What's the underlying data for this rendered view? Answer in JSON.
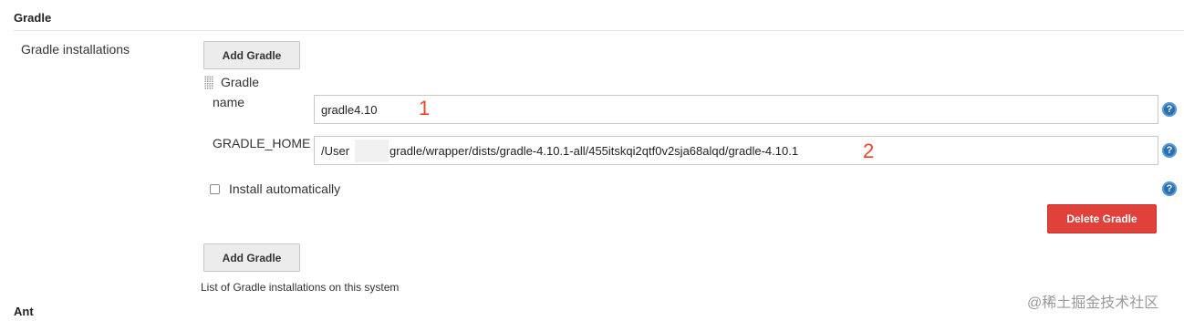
{
  "section_gradle": {
    "title": "Gradle"
  },
  "installations": {
    "label": "Gradle installations",
    "add_button_top": "Add Gradle",
    "add_button_bottom": "Add Gradle",
    "description": "List of Gradle installations on this system"
  },
  "gradle_item": {
    "header": "Gradle",
    "name_label": "name",
    "name_value": "gradle4.10",
    "home_label": "GRADLE_HOME",
    "home_value_start": "/User",
    "home_value_rest": "gradle/wrapper/dists/gradle-4.10.1-all/455itskqi2qtf0v2sja68alqd/gradle-4.10.1",
    "install_auto_label": "Install automatically",
    "install_auto_checked": false,
    "delete_button": "Delete Gradle"
  },
  "help_icon": {
    "glyph": "?"
  },
  "annotations": {
    "one": "1",
    "two": "2"
  },
  "section_ant": {
    "title": "Ant"
  },
  "watermark": "@稀土掘金技术社区",
  "colors": {
    "delete_button": "#e0413b",
    "annotation": "#e5462a",
    "help_icon": "#2a6fb0"
  }
}
